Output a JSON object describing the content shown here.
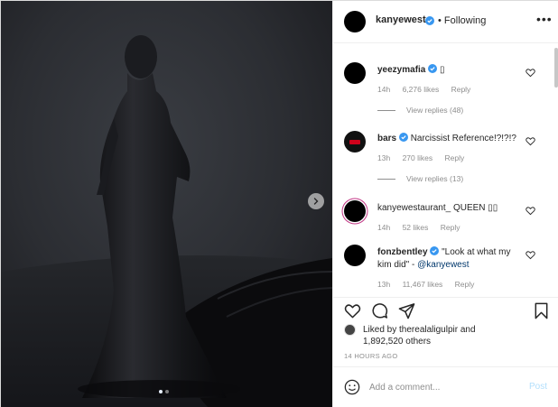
{
  "post": {
    "author": "kanyewest",
    "separator": "•",
    "follow_state": "Following",
    "more_glyph": "•••"
  },
  "comments": [
    {
      "username": "yeezymafia",
      "verified": true,
      "text": "▯",
      "time": "14h",
      "likes": "6,276 likes",
      "reply": "Reply",
      "view_replies": "View replies (48)"
    },
    {
      "username": "bars",
      "verified": true,
      "text": "Narcissist Reference!?!?!?",
      "time": "13h",
      "likes": "270 likes",
      "reply": "Reply",
      "view_replies": "View replies (13)"
    },
    {
      "username": "kanyewestaurant_",
      "verified": false,
      "text": "QUEEN ▯▯",
      "time": "14h",
      "likes": "52 likes",
      "reply": "Reply"
    },
    {
      "username": "fonzbentley",
      "verified": true,
      "text": "\"Look at what my kim did\" - ",
      "mention": "@kanyewest",
      "time": "13h",
      "likes": "11,467 likes",
      "reply": "Reply"
    }
  ],
  "likes": {
    "liked_by_prefix": "Liked by",
    "liked_by_user": "therealaligulpir",
    "and": "and",
    "others_count": "1,892,520 others"
  },
  "timestamp": "14 HOURS AGO",
  "composer": {
    "placeholder": "Add a comment...",
    "post_label": "Post"
  },
  "icons": {
    "like": "heart-icon",
    "comment": "comment-icon",
    "share": "share-icon",
    "save": "bookmark-icon",
    "emoji": "emoji-icon",
    "next": "chevron-right-icon",
    "verified": "verified-badge-icon"
  },
  "carousel": {
    "count": 2,
    "active": 1
  },
  "colors": {
    "verified": "#3897f0",
    "post_disabled": "#b2dffc",
    "meta_text": "#8e8e8e",
    "mention": "#00376b"
  }
}
